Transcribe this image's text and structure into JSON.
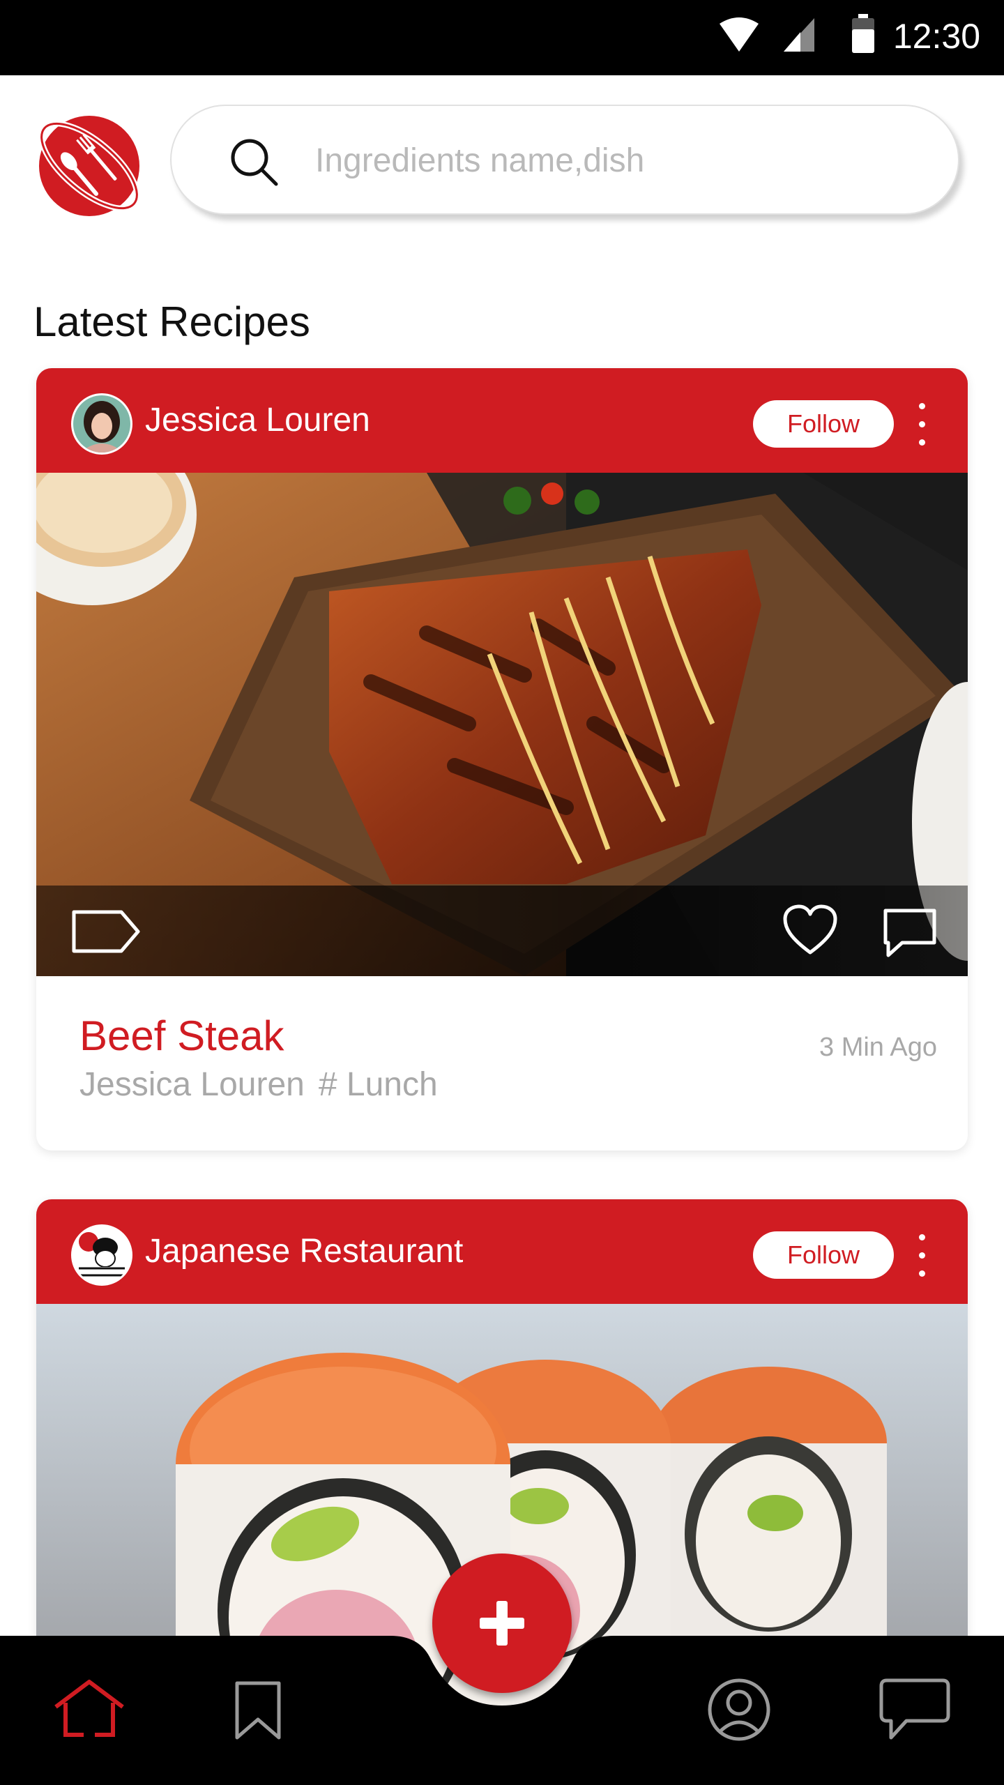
{
  "status_bar": {
    "time": "12:30",
    "icons": [
      "wifi-icon",
      "signal-icon",
      "battery-icon"
    ]
  },
  "header": {
    "logo": "planet-fork-spoon-logo",
    "search": {
      "placeholder": "Ingredients name,dish",
      "value": ""
    }
  },
  "section_title": "Latest Recipes",
  "colors": {
    "brand_red": "#d01c22",
    "muted_text": "#a8a8a8",
    "nav_bg": "#000000"
  },
  "recipes": [
    {
      "author": "Jessica Louren",
      "follow_label": "Follow",
      "image": "grilled-salmon-on-wooden-board",
      "title": "Beef Steak",
      "meta_author": "Jessica Louren",
      "meta_tag": "# Lunch",
      "time": "3 Min Ago"
    },
    {
      "author": "Japanese Restaurant",
      "follow_label": "Follow",
      "image": "salmon-sushi-rolls"
    }
  ],
  "bottom_nav": {
    "items": [
      "home-icon",
      "bookmark-icon",
      "add-icon",
      "profile-icon",
      "chat-icon"
    ],
    "active": "home-icon"
  }
}
